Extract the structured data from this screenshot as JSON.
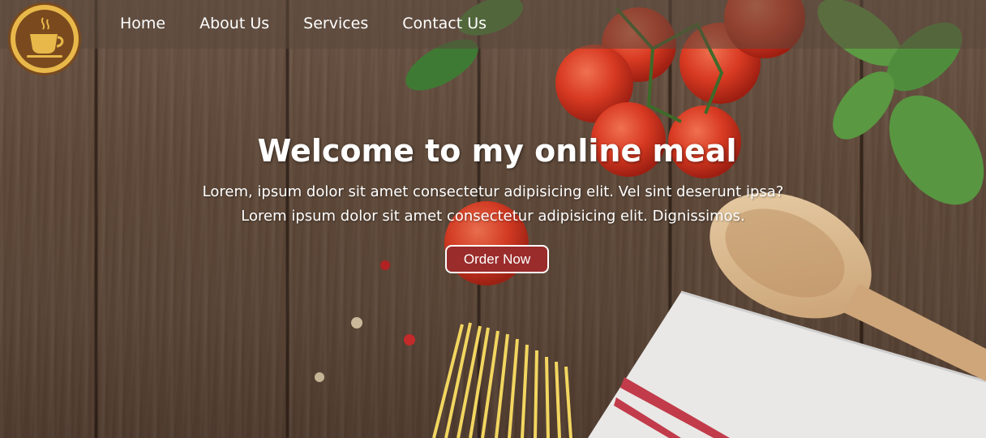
{
  "nav": {
    "logo_icon": "coffee-cup-icon",
    "links": [
      "Home",
      "About Us",
      "Services",
      "Contact Us"
    ]
  },
  "hero": {
    "title": "Welcome to my online meal",
    "description_line1": "Lorem, ipsum dolor sit amet consectetur adipisicing elit. Vel sint deserunt ipsa?",
    "description_line2": "Lorem ipsum dolor sit amet consectetur adipisicing elit. Dignissimos.",
    "cta_label": "Order Now"
  },
  "colors": {
    "accent": "#9b2c2c",
    "logo": "#e8b84a",
    "logo_dark": "#7a4a1e",
    "wood": "#5e4838"
  }
}
